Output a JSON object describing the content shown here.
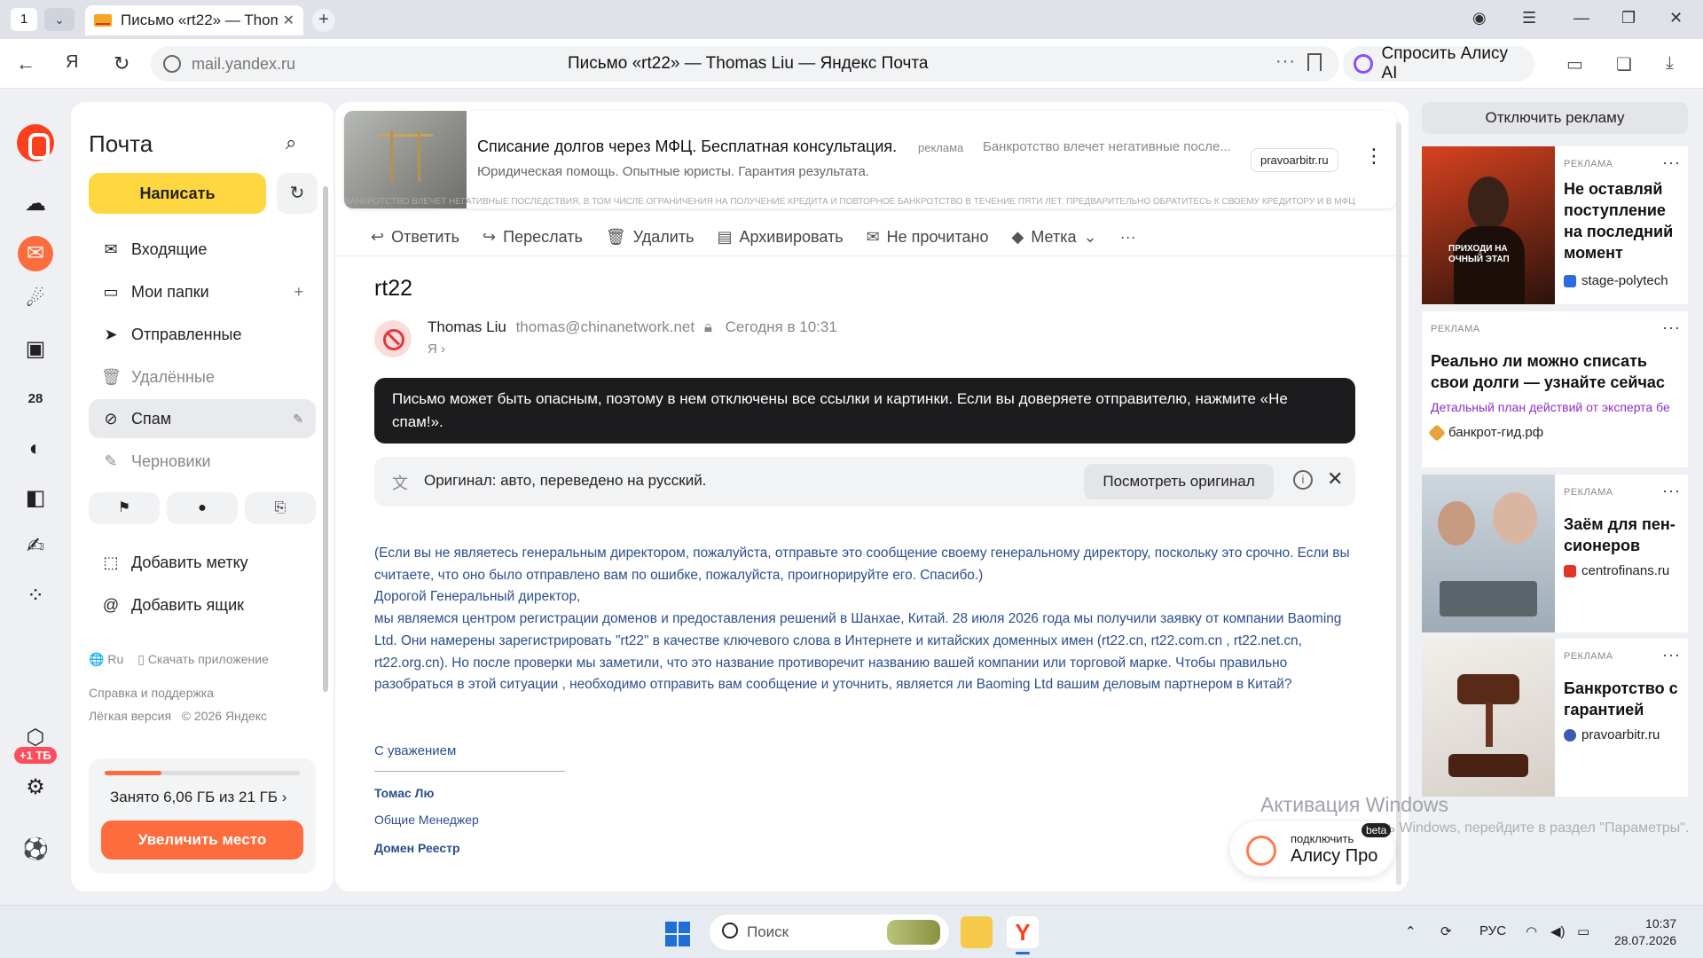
{
  "browser": {
    "tab_count": "1",
    "tab_title": "Письмо «rt22» — Thom",
    "url": "mail.yandex.ru",
    "page_title": "Письмо «rt22» — Thomas Liu — Яндекс Почта",
    "alisa_button": "Спросить Алису AI"
  },
  "folders": {
    "title": "Почта",
    "compose_label": "Написать",
    "items": [
      {
        "label": "Входящие",
        "icon": "inbox-icon"
      },
      {
        "label": "Мои папки",
        "icon": "folder-icon"
      },
      {
        "label": "Отправленные",
        "icon": "send-icon"
      },
      {
        "label": "Удалённые",
        "icon": "trash-icon"
      },
      {
        "label": "Спам",
        "icon": "spam-icon"
      },
      {
        "label": "Черновики",
        "icon": "draft-icon"
      }
    ],
    "add_label": "Добавить метку",
    "add_mailbox": "Добавить ящик",
    "lang": "Ru",
    "download_app": "Скачать приложение",
    "help": "Справка и поддержка",
    "light_version": "Лёгкая версия",
    "copyright": "© 2026 Яндекс",
    "storage_text": "Занято 6,06 ГБ из 21 ГБ",
    "storage_fraction": 0.29,
    "storage_button": "Увеличить место",
    "storage_badge": "+1 ТБ"
  },
  "top_ad": {
    "title": "Списание долгов через МФЦ. Бесплатная консультация.",
    "label": "реклама",
    "snippet": "Банкротство влечет негативные после...",
    "subtitle": "Юридическая помощь. Опытные юристы. Гарантия результата.",
    "domain": "pravoarbitr.ru",
    "fine_print": "БАНКРОТСТВО ВЛЕЧЕТ НЕГАТИВНЫЕ ПОСЛЕДСТВИЯ, В ТОМ ЧИСЛЕ ОГРАНИЧЕНИЯ НА ПОЛУЧЕНИЕ КРЕДИТА И ПОВТОРНОЕ БАНКРОТСТВО В ТЕЧЕНИЕ ПЯТИ ЛЕТ. ПРЕДВАРИТЕЛЬНО ОБРАТИТЕСЬ К СВОЕМУ КРЕДИТОРУ И В МФЦ"
  },
  "toolbar": {
    "reply": "Ответить",
    "forward": "Переслать",
    "delete": "Удалить",
    "archive": "Архивировать",
    "unread": "Не прочитано",
    "label": "Метка"
  },
  "message": {
    "subject": "rt22",
    "sender_name": "Thomas Liu",
    "sender_email": "thomas@chinanetwork.net",
    "date": "Сегодня в 10:31",
    "recipient": "Я",
    "warning": "Письмо может быть опасным, поэтому в нем отключены все ссылки и картинки. Если вы доверяете отправителю, нажмите «Не спам!».",
    "translation_note": "Оригинал: авто, переведено на русский.",
    "view_original": "Посмотреть оригинал",
    "body_p1": "(Если вы не являетесь генеральным директором, пожалуйста, отправьте это сообщение своему генеральному директору, поскольку это срочно. Если вы считаете, что оно было отправлено вам по ошибке, пожалуйста, проигнорируйте его. Спасибо.)",
    "body_p2": "Дорогой Генеральный директор,",
    "body_p3": "мы являемся центром регистрации доменов и предоставления решений в Шанхае, Китай. 28 июля 2026 года мы получили заявку от компании Baoming Ltd. Они намерены зарегистрировать \"rt22\" в качестве ключевого слова в Интернете и китайских доменных имен (rt22.cn, rt22.com.cn , rt22.net.cn, rt22.org.cn). Но после проверки мы заметили, что это название противоречит названию вашей компании или торговой марке. Чтобы правильно разобраться в этой ситуации , необходимо отправить вам сообщение и уточнить, является ли Baoming Ltd вашим деловым партнером в Китай?",
    "sign_off": "С уважением",
    "sig_name": "Томас Лю",
    "sig_title": "Общие Менеджер",
    "sig_company": "Домен Реестр"
  },
  "alisa_pro": {
    "line1": "подключить",
    "line2": "Алису Про",
    "badge": "beta"
  },
  "windows_activation": {
    "title": "Активация Windows",
    "subtitle": "Чтобы активировать Windows, перейдите в раздел \"Параметры\"."
  },
  "right_ads": {
    "disable_label": "Отключить рекламу",
    "ad_label": "РЕКЛАМА",
    "cards": [
      {
        "headline": "Не оставляй поступление на последний момент",
        "domain": "stage-polytech",
        "image_text": "ПРИХОДИ НА ОЧНЫЙ ЭТАП"
      },
      {
        "headline": "Реально ли можно списать свои долги — узнайте сейчас",
        "snippet": "Детальный план действий от эксперта бе",
        "domain": "банкрот-гид.рф"
      },
      {
        "headline": "Заём для пен-сионеров",
        "domain": "centrofinans.ru"
      },
      {
        "headline": "Банкротство с гарантией",
        "domain": "pravoarbitr.ru"
      }
    ]
  },
  "taskbar": {
    "search_placeholder": "Поиск",
    "language": "РУС",
    "time": "10:37",
    "date": "28.07.2026"
  }
}
